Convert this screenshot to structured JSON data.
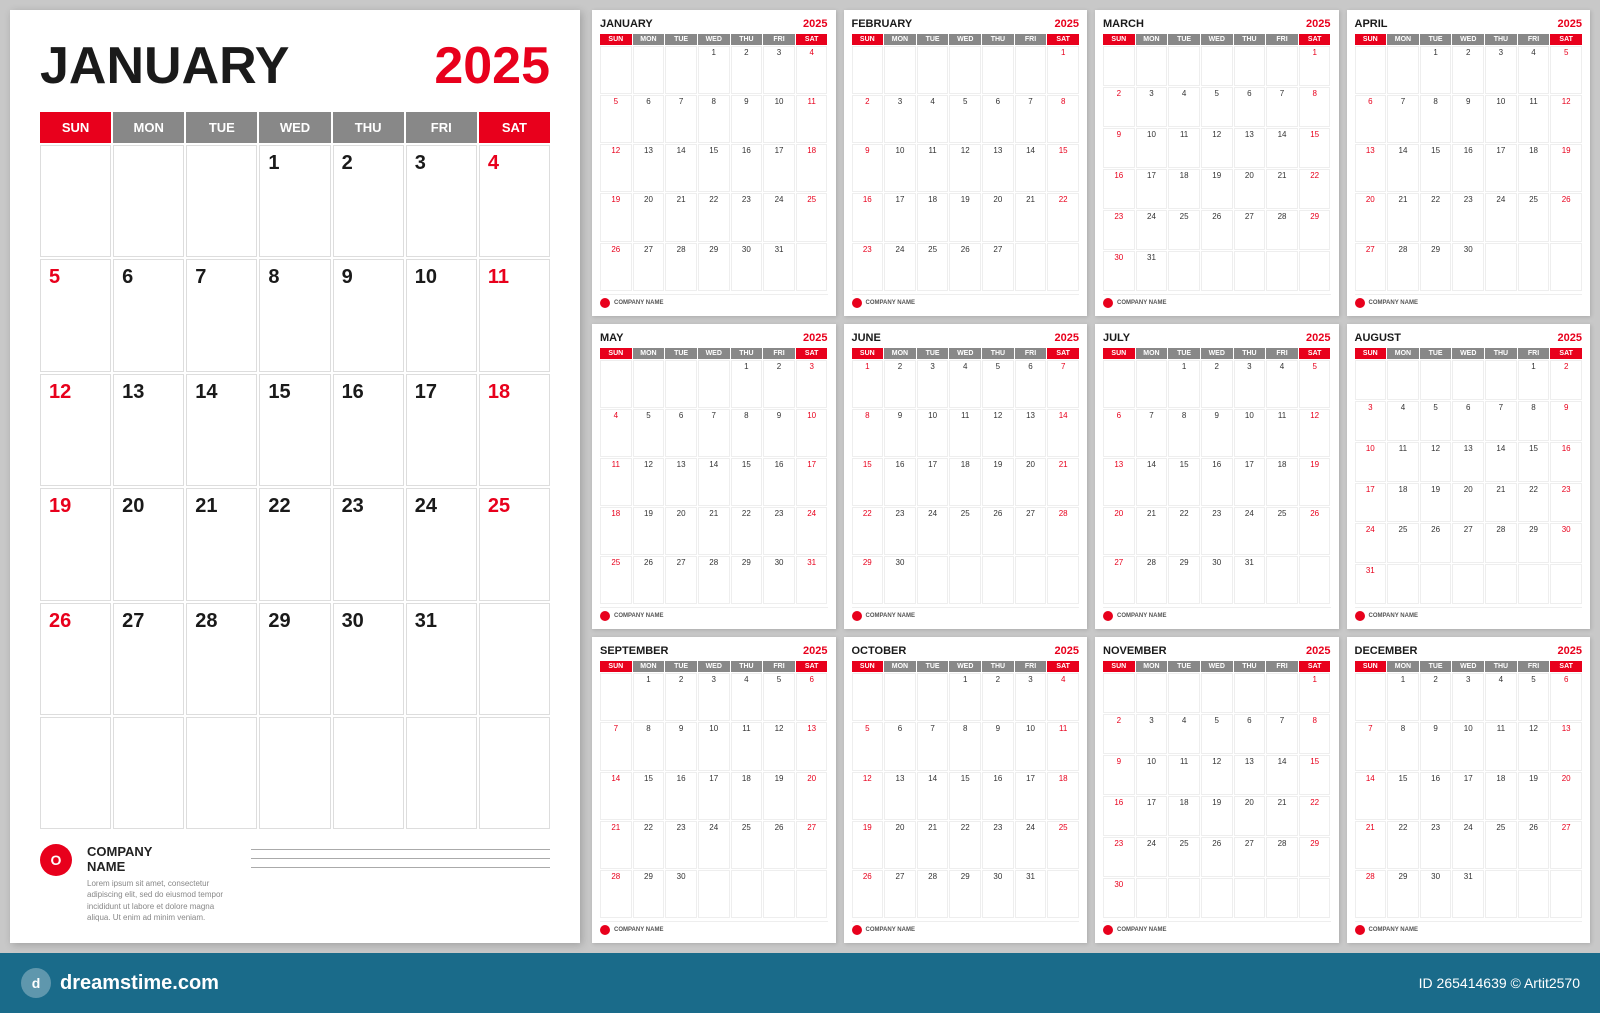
{
  "page": {
    "background": "#c8c8c8",
    "dreamstime": {
      "url": "dreamstime.com",
      "id": "265414639",
      "author": "Artit2570"
    }
  },
  "large_calendar": {
    "month": "JANUARY",
    "year": "2025",
    "days": [
      "SUN",
      "MON",
      "TUE",
      "WED",
      "THU",
      "FRI",
      "SAT"
    ],
    "weeks": [
      [
        "",
        "",
        "",
        "1",
        "2",
        "3",
        "4"
      ],
      [
        "5",
        "6",
        "7",
        "8",
        "9",
        "10",
        "11"
      ],
      [
        "12",
        "13",
        "14",
        "15",
        "16",
        "17",
        "18"
      ],
      [
        "19",
        "20",
        "21",
        "22",
        "23",
        "24",
        "25"
      ],
      [
        "26",
        "27",
        "28",
        "29",
        "30",
        "31",
        ""
      ],
      [
        "",
        "",
        "",
        "",
        "",
        "",
        ""
      ]
    ],
    "red_days": [
      "4",
      "11",
      "18",
      "25",
      "5",
      "12",
      "19",
      "26"
    ],
    "company": {
      "name": "COMPANY",
      "name2": "NAME",
      "desc": "Lorem ipsum sit amet, consectetur adipiscing elit, sed do eiusmod tempor incididunt ut labore et dolore magna aliqua. Ut enim ad minim veniam."
    }
  },
  "months": [
    {
      "name": "JANUARY",
      "year": "2025",
      "weeks": [
        [
          "",
          "",
          "",
          "1",
          "2",
          "3",
          "4"
        ],
        [
          "5",
          "6",
          "7",
          "8",
          "9",
          "10",
          "11"
        ],
        [
          "12",
          "13",
          "14",
          "15",
          "16",
          "17",
          "18"
        ],
        [
          "19",
          "20",
          "21",
          "22",
          "23",
          "24",
          "25"
        ],
        [
          "26",
          "27",
          "28",
          "29",
          "30",
          "31",
          ""
        ]
      ]
    },
    {
      "name": "FEBRUARY",
      "year": "2025",
      "weeks": [
        [
          "",
          "",
          "",
          "",
          "",
          "",
          "1"
        ],
        [
          "2",
          "3",
          "4",
          "5",
          "6",
          "7",
          "8"
        ],
        [
          "9",
          "10",
          "11",
          "12",
          "13",
          "14",
          "15"
        ],
        [
          "16",
          "17",
          "18",
          "19",
          "20",
          "21",
          "22"
        ],
        [
          "23",
          "24",
          "25",
          "26",
          "27",
          "",
          ""
        ]
      ]
    },
    {
      "name": "MARCH",
      "year": "2025",
      "weeks": [
        [
          "",
          "",
          "",
          "",
          "",
          "",
          "1"
        ],
        [
          "2",
          "3",
          "4",
          "5",
          "6",
          "7",
          "8"
        ],
        [
          "9",
          "10",
          "11",
          "12",
          "13",
          "14",
          "15"
        ],
        [
          "16",
          "17",
          "18",
          "19",
          "20",
          "21",
          "22"
        ],
        [
          "23",
          "24",
          "25",
          "26",
          "27",
          "28",
          "29"
        ],
        [
          "30",
          "31",
          "",
          "",
          "",
          "",
          ""
        ]
      ]
    },
    {
      "name": "APRIL",
      "year": "2025",
      "weeks": [
        [
          "",
          "",
          "1",
          "2",
          "3",
          "4",
          "5"
        ],
        [
          "6",
          "7",
          "8",
          "9",
          "10",
          "11",
          "12"
        ],
        [
          "13",
          "14",
          "15",
          "16",
          "17",
          "18",
          "19"
        ],
        [
          "20",
          "21",
          "22",
          "23",
          "24",
          "25",
          "26"
        ],
        [
          "27",
          "28",
          "29",
          "30",
          "",
          "",
          ""
        ]
      ]
    },
    {
      "name": "MAY",
      "year": "2025",
      "weeks": [
        [
          "",
          "",
          "",
          "",
          "1",
          "2",
          "3"
        ],
        [
          "4",
          "5",
          "6",
          "7",
          "8",
          "9",
          "10"
        ],
        [
          "11",
          "12",
          "13",
          "14",
          "15",
          "16",
          "17"
        ],
        [
          "18",
          "19",
          "20",
          "21",
          "22",
          "23",
          "24"
        ],
        [
          "25",
          "26",
          "27",
          "28",
          "29",
          "30",
          "31"
        ]
      ]
    },
    {
      "name": "JUNE",
      "year": "2025",
      "weeks": [
        [
          "1",
          "2",
          "3",
          "4",
          "5",
          "6",
          "7"
        ],
        [
          "8",
          "9",
          "10",
          "11",
          "12",
          "13",
          "14"
        ],
        [
          "15",
          "16",
          "17",
          "18",
          "19",
          "20",
          "21"
        ],
        [
          "22",
          "23",
          "24",
          "25",
          "26",
          "27",
          "28"
        ],
        [
          "29",
          "30",
          "",
          "",
          "",
          "",
          ""
        ]
      ]
    },
    {
      "name": "JULY",
      "year": "2025",
      "weeks": [
        [
          "",
          "",
          "1",
          "2",
          "3",
          "4",
          "5"
        ],
        [
          "6",
          "7",
          "8",
          "9",
          "10",
          "11",
          "12"
        ],
        [
          "13",
          "14",
          "15",
          "16",
          "17",
          "18",
          "19"
        ],
        [
          "20",
          "21",
          "22",
          "23",
          "24",
          "25",
          "26"
        ],
        [
          "27",
          "28",
          "29",
          "30",
          "31",
          "",
          ""
        ]
      ]
    },
    {
      "name": "AUGUST",
      "year": "2025",
      "weeks": [
        [
          "",
          "",
          "",
          "",
          "",
          "1",
          "2"
        ],
        [
          "3",
          "4",
          "5",
          "6",
          "7",
          "8",
          "9"
        ],
        [
          "10",
          "11",
          "12",
          "13",
          "14",
          "15",
          "16"
        ],
        [
          "17",
          "18",
          "19",
          "20",
          "21",
          "22",
          "23"
        ],
        [
          "24",
          "25",
          "26",
          "27",
          "28",
          "29",
          "30"
        ],
        [
          "31",
          "",
          "",
          "",
          "",
          "",
          ""
        ]
      ]
    },
    {
      "name": "SEPTEMBER",
      "year": "2025",
      "weeks": [
        [
          "",
          "1",
          "2",
          "3",
          "4",
          "5",
          "6"
        ],
        [
          "7",
          "8",
          "9",
          "10",
          "11",
          "12",
          "13"
        ],
        [
          "14",
          "15",
          "16",
          "17",
          "18",
          "19",
          "20"
        ],
        [
          "21",
          "22",
          "23",
          "24",
          "25",
          "26",
          "27"
        ],
        [
          "28",
          "29",
          "30",
          "",
          "",
          "",
          ""
        ]
      ]
    },
    {
      "name": "OCTOBER",
      "year": "2025",
      "weeks": [
        [
          "",
          "",
          "",
          "1",
          "2",
          "3",
          "4"
        ],
        [
          "5",
          "6",
          "7",
          "8",
          "9",
          "10",
          "11"
        ],
        [
          "12",
          "13",
          "14",
          "15",
          "16",
          "17",
          "18"
        ],
        [
          "19",
          "20",
          "21",
          "22",
          "23",
          "24",
          "25"
        ],
        [
          "26",
          "27",
          "28",
          "29",
          "30",
          "31",
          ""
        ]
      ]
    },
    {
      "name": "NOVEMBER",
      "year": "2025",
      "weeks": [
        [
          "",
          "",
          "",
          "",
          "",
          "",
          "1"
        ],
        [
          "2",
          "3",
          "4",
          "5",
          "6",
          "7",
          "8"
        ],
        [
          "9",
          "10",
          "11",
          "12",
          "13",
          "14",
          "15"
        ],
        [
          "16",
          "17",
          "18",
          "19",
          "20",
          "21",
          "22"
        ],
        [
          "23",
          "24",
          "25",
          "26",
          "27",
          "28",
          "29"
        ],
        [
          "30",
          "",
          "",
          "",
          "",
          "",
          ""
        ]
      ]
    },
    {
      "name": "DECEMBER",
      "year": "2025",
      "weeks": [
        [
          "",
          "1",
          "2",
          "3",
          "4",
          "5",
          "6"
        ],
        [
          "7",
          "8",
          "9",
          "10",
          "11",
          "12",
          "13"
        ],
        [
          "14",
          "15",
          "16",
          "17",
          "18",
          "19",
          "20"
        ],
        [
          "21",
          "22",
          "23",
          "24",
          "25",
          "26",
          "27"
        ],
        [
          "28",
          "29",
          "30",
          "31",
          "",
          "",
          ""
        ]
      ]
    }
  ],
  "day_labels": [
    "SUN",
    "MON",
    "TUE",
    "WED",
    "THU",
    "FRI",
    "SAT"
  ]
}
